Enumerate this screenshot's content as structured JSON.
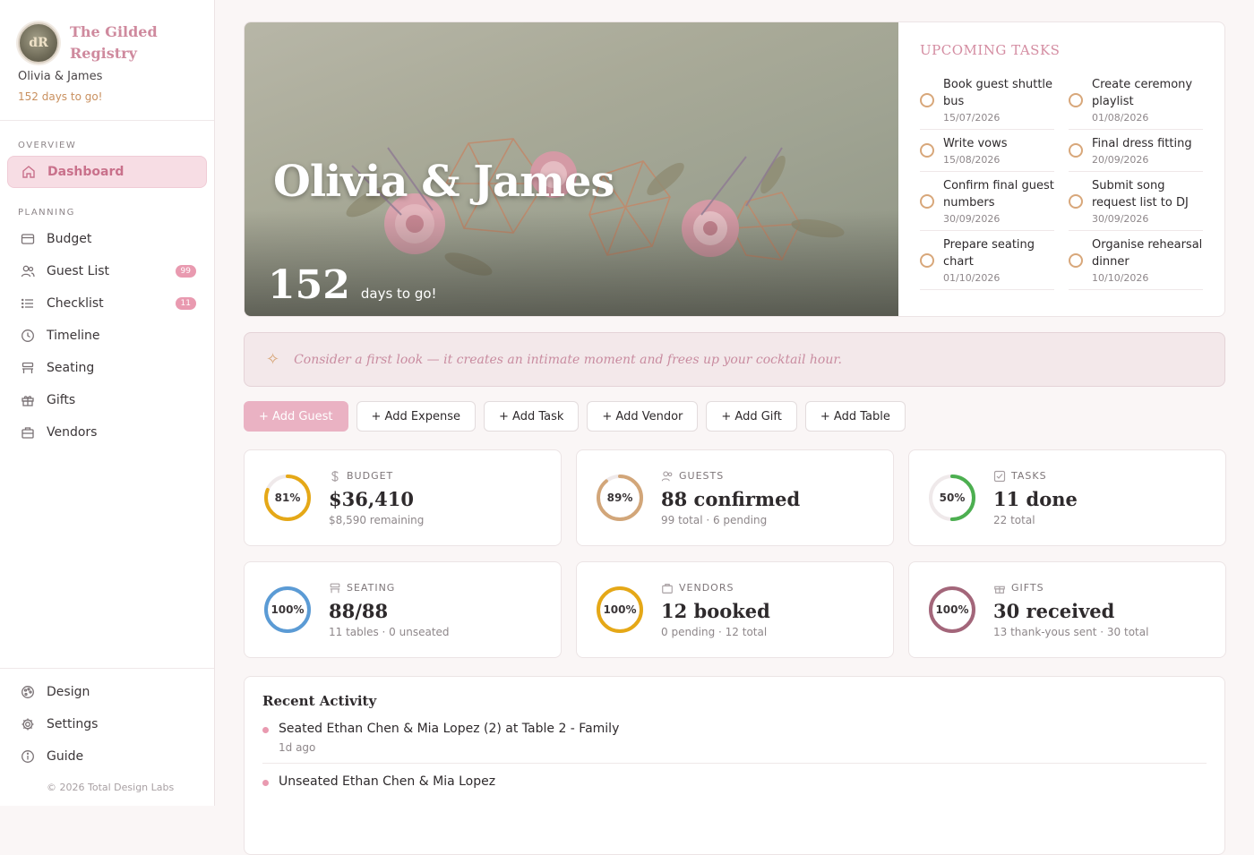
{
  "brand": {
    "logo_text": "dR",
    "title": "The Gilded Registry",
    "couple": "Olivia & James",
    "days_left": "152 days to go!"
  },
  "nav": {
    "overview_heading": "OVERVIEW",
    "planning_heading": "PLANNING",
    "dashboard": "Dashboard",
    "items": [
      {
        "label": "Budget",
        "icon": "wallet-icon"
      },
      {
        "label": "Guest List",
        "icon": "users-icon",
        "badge": "99"
      },
      {
        "label": "Checklist",
        "icon": "list-icon",
        "badge": "11"
      },
      {
        "label": "Timeline",
        "icon": "clock-icon"
      },
      {
        "label": "Seating",
        "icon": "chair-icon"
      },
      {
        "label": "Gifts",
        "icon": "gift-icon"
      },
      {
        "label": "Vendors",
        "icon": "briefcase-icon"
      }
    ],
    "bottom": [
      {
        "label": "Design",
        "icon": "palette-icon"
      },
      {
        "label": "Settings",
        "icon": "gear-icon"
      },
      {
        "label": "Guide",
        "icon": "info-icon"
      }
    ],
    "copyright": "© 2026 Total Design Labs"
  },
  "hero": {
    "title": "Olivia & James",
    "days_number": "152",
    "days_text": "days to go!"
  },
  "tasks": {
    "title": "UPCOMING TASKS",
    "items": [
      {
        "name": "Book guest shuttle bus",
        "date": "15/07/2026"
      },
      {
        "name": "Create ceremony playlist",
        "date": "01/08/2026"
      },
      {
        "name": "Write vows",
        "date": "15/08/2026"
      },
      {
        "name": "Final dress fitting",
        "date": "20/09/2026"
      },
      {
        "name": "Confirm final guest numbers",
        "date": "30/09/2026"
      },
      {
        "name": "Submit song request list to DJ",
        "date": "30/09/2026"
      },
      {
        "name": "Prepare seating chart",
        "date": "01/10/2026"
      },
      {
        "name": "Organise rehearsal dinner",
        "date": "10/10/2026"
      }
    ]
  },
  "tip": {
    "icon": "sparkle-icon",
    "text": "Consider a first look — it creates an intimate moment and frees up your cocktail hour."
  },
  "actions": [
    "+ Add Guest",
    "+ Add Expense",
    "+ Add Task",
    "+ Add Vendor",
    "+ Add Gift",
    "+ Add Table"
  ],
  "stats": [
    {
      "label": "BUDGET",
      "icon": "dollar-icon",
      "percent": 81,
      "percent_text": "81%",
      "value": "$36,410",
      "sub": "$8,590 remaining",
      "color": "#e5a817"
    },
    {
      "label": "GUESTS",
      "icon": "users-icon",
      "percent": 89,
      "percent_text": "89%",
      "value": "88 confirmed",
      "sub": "99 total · 6 pending",
      "color": "#d2a679"
    },
    {
      "label": "TASKS",
      "icon": "checkbox-icon",
      "percent": 50,
      "percent_text": "50%",
      "value": "11 done",
      "sub": "22 total",
      "color": "#4caf50"
    },
    {
      "label": "SEATING",
      "icon": "chair-icon",
      "percent": 100,
      "percent_text": "100%",
      "value": "88/88",
      "sub": "11 tables · 0 unseated",
      "color": "#5b9bd5"
    },
    {
      "label": "VENDORS",
      "icon": "briefcase-icon",
      "percent": 100,
      "percent_text": "100%",
      "value": "12 booked",
      "sub": "0 pending · 12 total",
      "color": "#e5a817"
    },
    {
      "label": "GIFTS",
      "icon": "gift-icon",
      "percent": 100,
      "percent_text": "100%",
      "value": "30 received",
      "sub": "13 thank-yous sent · 30 total",
      "color": "#a3667a"
    }
  ],
  "activity": {
    "title": "Recent Activity",
    "items": [
      {
        "text": "Seated Ethan Chen & Mia Lopez (2) at Table 2 - Family",
        "time": "1d ago"
      },
      {
        "text": "Unseated Ethan Chen & Mia Lopez",
        "time": ""
      }
    ]
  },
  "colors": {
    "accent_pink": "#e99ab0",
    "accent_gold": "#d8a77a",
    "sidebar_active_bg": "#f7dde4"
  }
}
